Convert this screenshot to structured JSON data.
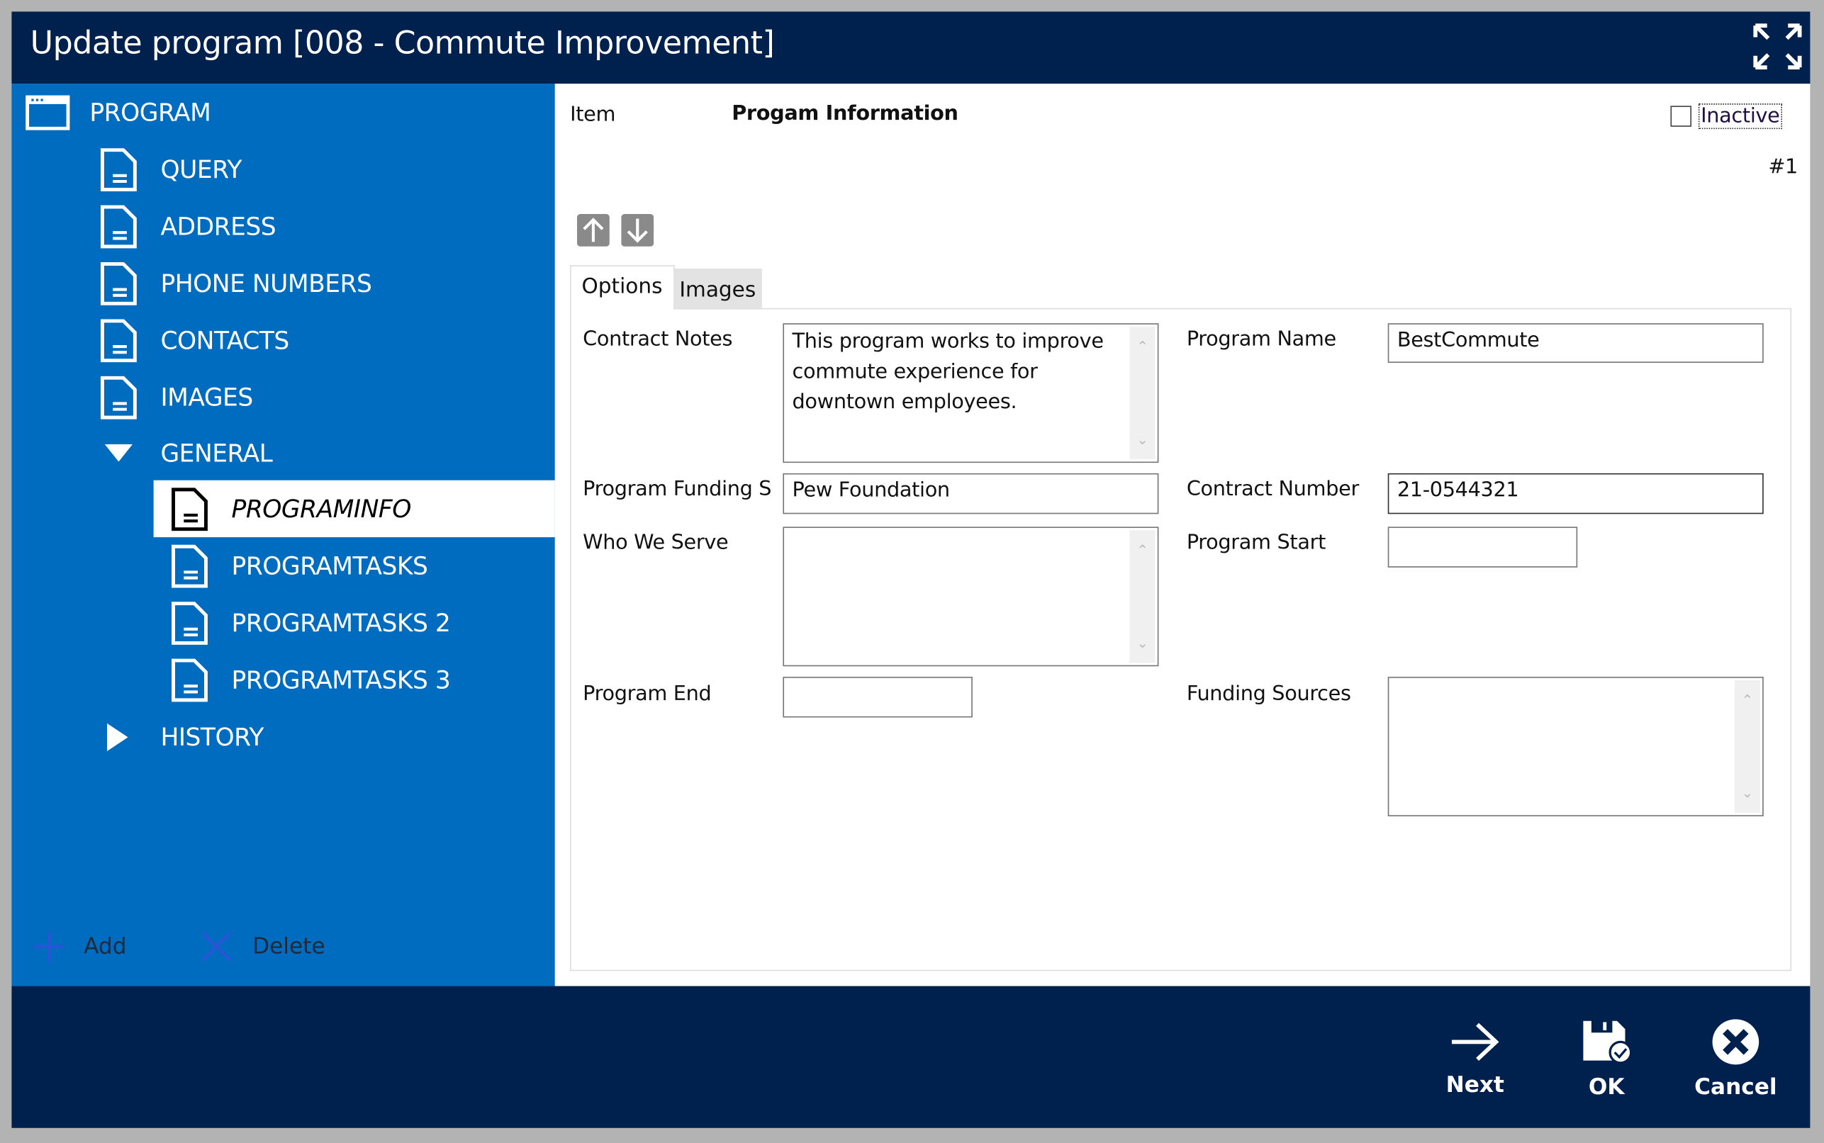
{
  "window": {
    "title": "Update program [008 - Commute Improvement]"
  },
  "sidebar": {
    "root": {
      "label": "PROGRAM"
    },
    "items": [
      {
        "label": "QUERY"
      },
      {
        "label": "ADDRESS"
      },
      {
        "label": "PHONE NUMBERS"
      },
      {
        "label": "CONTACTS"
      },
      {
        "label": "IMAGES"
      },
      {
        "label": "GENERAL",
        "expanded": true
      },
      {
        "label": "PROGRAMINFO",
        "selected": true
      },
      {
        "label": "PROGRAMTASKS"
      },
      {
        "label": "PROGRAMTASKS 2"
      },
      {
        "label": "PROGRAMTASKS 3"
      },
      {
        "label": "HISTORY",
        "expanded": false
      }
    ],
    "add_label": "Add",
    "delete_label": "Delete"
  },
  "header": {
    "item_label": "Item",
    "item_value": "Progam Information",
    "inactive_label": "Inactive",
    "inactive_checked": false,
    "record_number": "#1"
  },
  "tabs": [
    {
      "label": "Options",
      "active": true
    },
    {
      "label": "Images",
      "active": false
    }
  ],
  "form": {
    "contract_notes": {
      "label": "Contract Notes",
      "value": "This program works to improve commute experience for downtown employees."
    },
    "program_funding": {
      "label": "Program Funding S",
      "value": "Pew Foundation"
    },
    "who_we_serve": {
      "label": "Who We Serve",
      "value": ""
    },
    "program_end": {
      "label": "Program End",
      "value": ""
    },
    "program_name": {
      "label": "Program Name",
      "value": "BestCommute"
    },
    "contract_number": {
      "label": "Contract Number",
      "value": "21-0544321"
    },
    "program_start": {
      "label": "Program Start",
      "value": ""
    },
    "funding_sources": {
      "label": "Funding Sources",
      "value": ""
    }
  },
  "footer": {
    "next_label": "Next",
    "ok_label": "OK",
    "cancel_label": "Cancel"
  },
  "colors": {
    "titlebar": "#00204d",
    "sidebar": "#006cc0"
  }
}
